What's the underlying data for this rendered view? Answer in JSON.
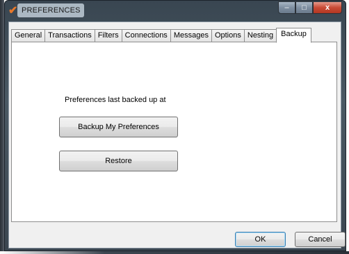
{
  "window": {
    "title": "PREFERENCES",
    "app_icon": "checkmark-icon",
    "controls": {
      "minimize": "–",
      "maximize": "□",
      "close": "x"
    }
  },
  "tabs": [
    {
      "label": "General",
      "active": false
    },
    {
      "label": "Transactions",
      "active": false
    },
    {
      "label": "Filters",
      "active": false
    },
    {
      "label": "Connections",
      "active": false
    },
    {
      "label": "Messages",
      "active": false
    },
    {
      "label": "Options",
      "active": false
    },
    {
      "label": "Nesting",
      "active": false
    },
    {
      "label": "Backup",
      "active": true
    }
  ],
  "backup": {
    "last_backup_label": "Preferences last backed up at",
    "backup_button": "Backup My Preferences",
    "restore_button": "Restore"
  },
  "footer": {
    "ok_label": "OK",
    "cancel_label": "Cancel"
  },
  "colors": {
    "title_bar": "#4b5964",
    "close_button": "#c84a35",
    "dialog_background": "#f0f0f0"
  }
}
